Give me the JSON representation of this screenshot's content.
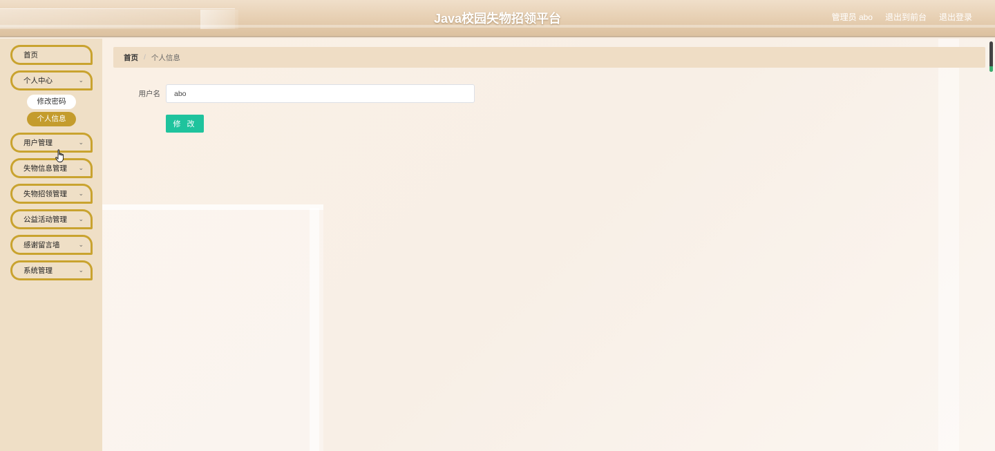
{
  "header": {
    "title": "Java校园失物招领平台",
    "user_label": "管理员 abo",
    "to_front_label": "退出到前台",
    "logout_label": "退出登录"
  },
  "sidebar": {
    "items": [
      {
        "label": "首页",
        "has_chevron": false
      },
      {
        "label": "个人中心",
        "has_chevron": true,
        "expanded": true,
        "children": [
          {
            "label": "修改密码",
            "active": false
          },
          {
            "label": "个人信息",
            "active": true
          }
        ]
      },
      {
        "label": "用户管理",
        "has_chevron": true
      },
      {
        "label": "失物信息管理",
        "has_chevron": true
      },
      {
        "label": "失物招领管理",
        "has_chevron": true
      },
      {
        "label": "公益活动管理",
        "has_chevron": true
      },
      {
        "label": "感谢留言墙",
        "has_chevron": true
      },
      {
        "label": "系统管理",
        "has_chevron": true
      }
    ],
    "chevron_icon": "chevron-down-icon"
  },
  "breadcrumb": {
    "home": "首页",
    "separator": "/",
    "current": "个人信息"
  },
  "form": {
    "username_label": "用户名",
    "username_value": "abo",
    "submit_label": "修 改"
  },
  "colors": {
    "accent_gold": "#c9a32f",
    "active_sub_bg": "#c49c2d",
    "submit_green": "#1fc39d",
    "sidebar_bg": "#efdfc6"
  }
}
